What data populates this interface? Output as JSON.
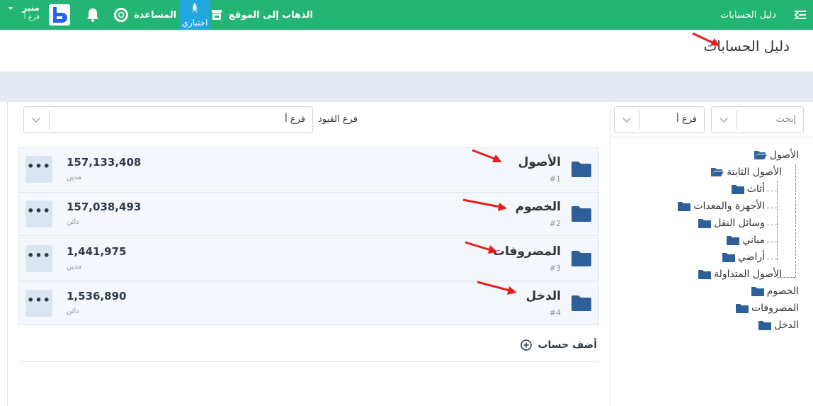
{
  "topbar": {
    "app_title": "دليل الحسابات",
    "go_to_site": "الذهاب إلى الموقع",
    "trial": "اختباري",
    "help": "المساعدة",
    "user_name": "منير",
    "user_branch": "فرع أ"
  },
  "page": {
    "title": "دليل الحسابات"
  },
  "search": {
    "placeholder": "إبحث",
    "branch_value": "فرع أ"
  },
  "filter": {
    "label": "فرع القيود",
    "value": "فرع أ"
  },
  "accounts": [
    {
      "name": "الأصول",
      "number": "#1",
      "balance": "157,133,408",
      "type": "مدين",
      "more": "•••"
    },
    {
      "name": "الخصوم",
      "number": "#2",
      "balance": "157,038,493",
      "type": "دائن",
      "more": "•••"
    },
    {
      "name": "المصروفات",
      "number": "#3",
      "balance": "1,441,975",
      "type": "مدين",
      "more": "•••"
    },
    {
      "name": "الدخل",
      "number": "#4",
      "balance": "1,536,890",
      "type": "دائن",
      "more": "•••"
    }
  ],
  "add_account": "أضف حساب",
  "tree": {
    "n0": "الأصول",
    "n1": "الأصول الثابتة",
    "n2": "أثاث",
    "n3": "الأجهزة والمعدات",
    "n4": "وسائل النقل",
    "n5": "مباني",
    "n6": "أراضي",
    "n7": "الأصول المتداولة",
    "n8": "الخصوم",
    "n9": "المصروفات",
    "n10": "الدخل"
  },
  "colors": {
    "topbar": "#22b573",
    "trial": "#21a6df",
    "folder": "#2f5f98",
    "arrow": "#e02020"
  }
}
